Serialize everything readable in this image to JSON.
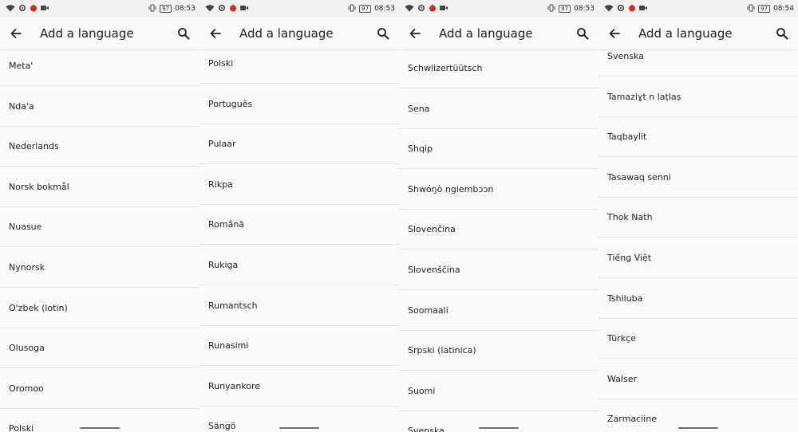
{
  "app_bar": {
    "title": "Add a language",
    "back_icon": "arrow-back-icon",
    "search_icon": "search-icon"
  },
  "colors": {
    "background": "#fafafa",
    "status_bar": "#f2f2f2",
    "divider": "#e4e4e4",
    "text": "#222222",
    "app_icon_red": "#d52b1e"
  },
  "screens": [
    {
      "status": {
        "battery": "97",
        "time": "08:53"
      },
      "languages": [
        "Meta'",
        "Nda'a",
        "Nederlands",
        "Norsk bokmål",
        "Nuasue",
        "Nynorsk",
        "O'zbek (lotin)",
        "Olusoga",
        "Oromoo",
        "Polski"
      ]
    },
    {
      "status": {
        "battery": "97",
        "time": "08:53"
      },
      "languages": [
        "Polski",
        "Português",
        "Pulaar",
        "Rikpa",
        "Română",
        "Rukiga",
        "Rumantsch",
        "Runasimi",
        "Runyankore",
        "Sängö"
      ]
    },
    {
      "status": {
        "battery": "97",
        "time": "08:53"
      },
      "languages": [
        "Schwiizertüütsch",
        "Sena",
        "Shqip",
        "Shwóŋò ngiembɔɔn",
        "Slovenčina",
        "Slovenščina",
        "Soomaali",
        "Srpski (latinica)",
        "Suomi",
        "Svenska"
      ]
    },
    {
      "status": {
        "battery": "97",
        "time": "08:54"
      },
      "languages": [
        "Svenska",
        "Tamaziɣt n laṭlaṣ",
        "Taqbaylit",
        "Tasawaq senni",
        "Thok Nath",
        "Tiếng Việt",
        "Tshiluba",
        "Türkçe",
        "Walser",
        "Zarmaciine"
      ]
    }
  ]
}
